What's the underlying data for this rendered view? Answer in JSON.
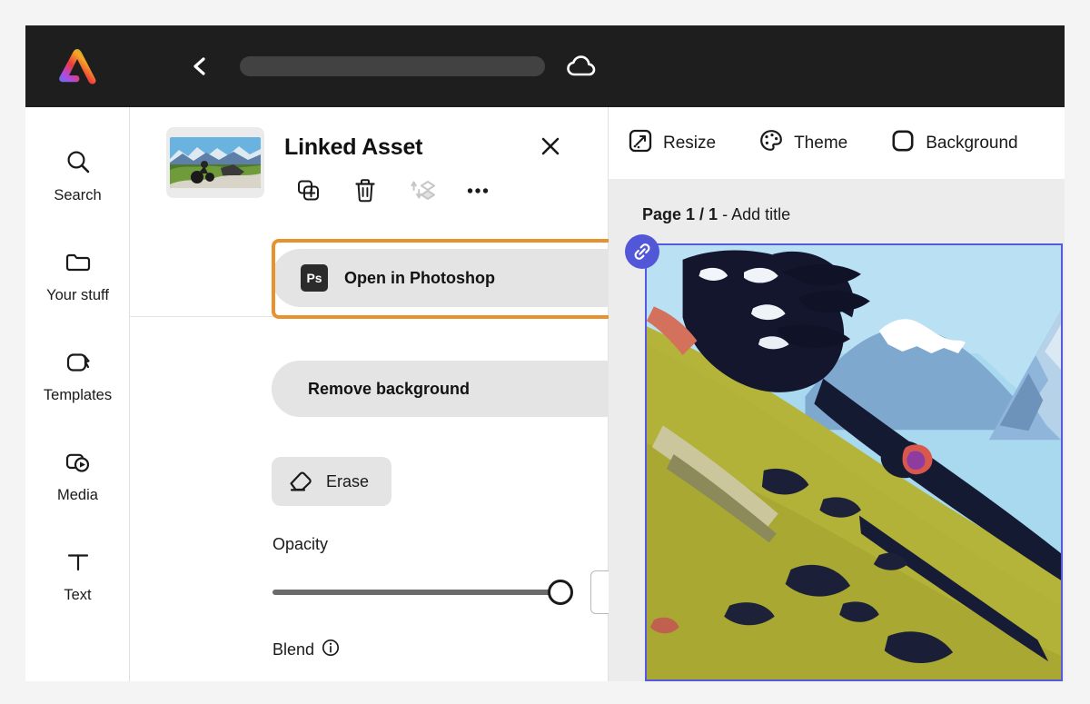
{
  "header": {
    "logo_icon": "adobe-express-logo",
    "back_icon": "back-chevron-icon",
    "doc_title_placeholder": "",
    "cloud_icon": "cloud-icon"
  },
  "sidebar": {
    "items": [
      {
        "label": "Search",
        "icon": "search-icon"
      },
      {
        "label": "Your stuff",
        "icon": "folder-icon"
      },
      {
        "label": "Templates",
        "icon": "templates-icon"
      },
      {
        "label": "Media",
        "icon": "media-icon"
      },
      {
        "label": "Text",
        "icon": "text-icon"
      }
    ]
  },
  "panel": {
    "title": "Linked Asset",
    "close_icon": "close-icon",
    "thumbnail_alt": "motorcycle on mountain road",
    "actions": [
      {
        "name": "duplicate-icon",
        "label": "Duplicate",
        "disabled": false
      },
      {
        "name": "delete-icon",
        "label": "Delete",
        "disabled": false
      },
      {
        "name": "layer-order-icon",
        "label": "Layer order",
        "disabled": true
      },
      {
        "name": "more-options-icon",
        "label": "More options",
        "disabled": false
      }
    ],
    "photoshop_button": {
      "label": "Open in Photoshop",
      "badge": "Ps",
      "highlight_color": "#e8912d"
    },
    "remove_background_label": "Remove background",
    "erase": {
      "label": "Erase",
      "icon": "eraser-icon"
    },
    "opacity": {
      "label": "Opacity",
      "value": "100%",
      "percent": 100
    },
    "blend": {
      "label": "Blend",
      "info_icon": "info-icon"
    }
  },
  "toolbar": {
    "items": [
      {
        "label": "Resize",
        "icon": "resize-icon"
      },
      {
        "label": "Theme",
        "icon": "palette-icon"
      },
      {
        "label": "Background",
        "icon": "background-icon"
      }
    ]
  },
  "canvas": {
    "page_label_bold": "Page 1 / 1",
    "page_label_rest": " - Add title",
    "link_badge_icon": "link-icon",
    "selection_color": "#5659e0"
  }
}
